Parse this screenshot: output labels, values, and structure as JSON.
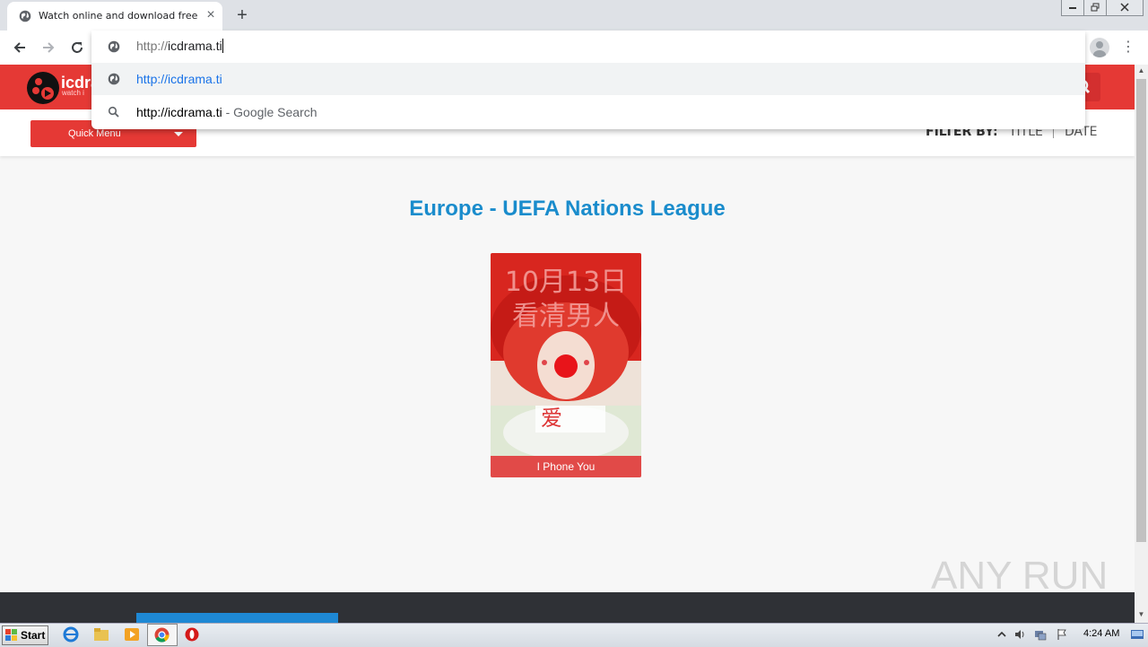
{
  "browser": {
    "tab_title": "Watch online and download free Asi",
    "close_tab_glyph": "×",
    "new_tab_glyph": "+",
    "menu_glyph": "⋮",
    "omnibox": {
      "prefix": "http://",
      "host": "icdrama.ti",
      "suggestions": [
        {
          "icon": "globe-icon",
          "text": "http://icdrama.ti",
          "sub": ""
        },
        {
          "icon": "search-icon",
          "text": "http://icdrama.ti",
          "sub": " - Google Search"
        }
      ]
    }
  },
  "site": {
    "logo_text": "icdra",
    "logo_sub": "watch i",
    "quick_menu_label": "Quick Menu",
    "filter": {
      "label": "FILTER BY:",
      "option_title": "TITLE",
      "option_date": "DATE"
    },
    "page_title": "Europe - UEFA Nations League",
    "items": [
      {
        "caption": "I Phone You",
        "poster_text": "10月13日 看清男人"
      }
    ],
    "watermark": "ANY RUN"
  },
  "taskbar": {
    "start_label": "Start",
    "clock": "4:24 AM"
  },
  "colors": {
    "brand_red": "#e53935",
    "title_blue": "#1a8ccc",
    "link_blue": "#1a73e8"
  }
}
